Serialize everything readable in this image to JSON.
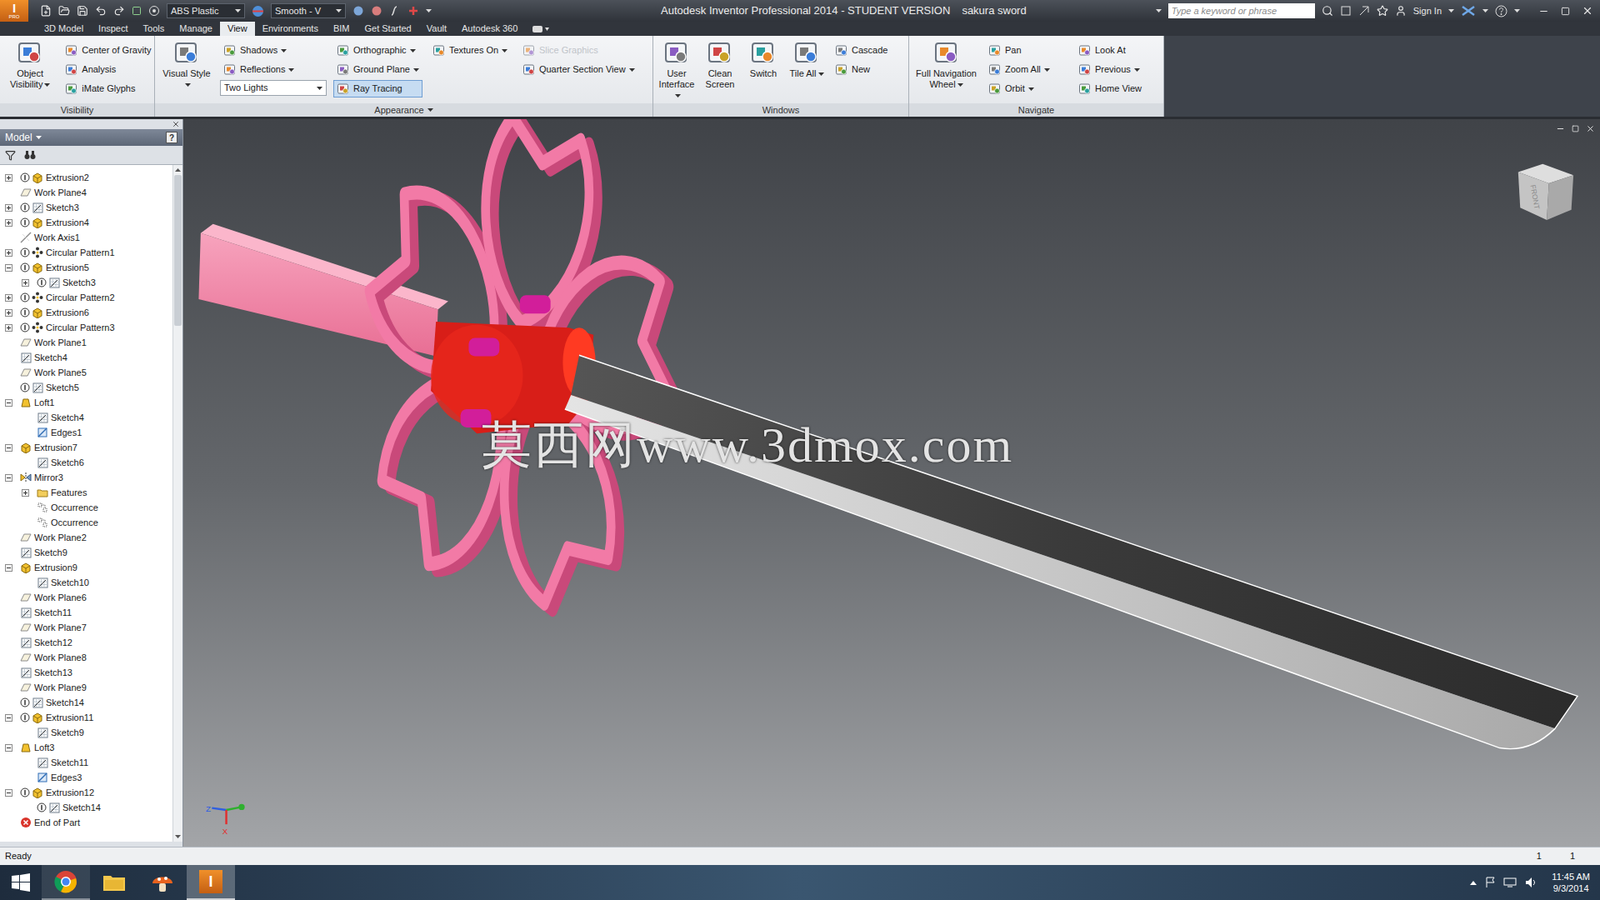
{
  "window": {
    "app_letter": "I",
    "app_edition": "PRO",
    "title": "Autodesk Inventor Professional 2014 - STUDENT VERSION",
    "document": "sakura sword"
  },
  "quick_access": {
    "material": "ABS Plastic",
    "appearance": "Smooth - V"
  },
  "search": {
    "placeholder": "Type a keyword or phrase"
  },
  "account": {
    "sign_in": "Sign In"
  },
  "ribbon_tabs": [
    {
      "label": "3D Model",
      "selected": false
    },
    {
      "label": "Inspect",
      "selected": false
    },
    {
      "label": "Tools",
      "selected": false
    },
    {
      "label": "Manage",
      "selected": false
    },
    {
      "label": "View",
      "selected": true
    },
    {
      "label": "Environments",
      "selected": false
    },
    {
      "label": "BIM",
      "selected": false
    },
    {
      "label": "Get Started",
      "selected": false
    },
    {
      "label": "Vault",
      "selected": false
    },
    {
      "label": "Autodesk 360",
      "selected": false
    }
  ],
  "ribbon_panels": [
    {
      "title": "Visibility",
      "dropdown": false,
      "large": [
        {
          "label": "Object Visibility",
          "dropdown": true
        }
      ],
      "columns": [
        [
          {
            "label": "Center of Gravity",
            "kind": "button",
            "dropdown": false,
            "selected": false,
            "disabled": false
          },
          {
            "label": "Analysis",
            "kind": "button",
            "dropdown": false,
            "selected": false,
            "disabled": false
          },
          {
            "label": "iMate Glyphs",
            "kind": "button",
            "dropdown": false,
            "selected": false,
            "disabled": false
          }
        ]
      ]
    },
    {
      "title": "Appearance",
      "dropdown": true,
      "large": [
        {
          "label": "Visual Style",
          "dropdown": true
        }
      ],
      "columns": [
        [
          {
            "label": "Shadows",
            "kind": "button",
            "dropdown": true,
            "selected": false,
            "disabled": false
          },
          {
            "label": "Reflections",
            "kind": "button",
            "dropdown": true,
            "selected": false,
            "disabled": false
          },
          {
            "label": "Two Lights",
            "kind": "combo",
            "dropdown": true,
            "selected": false,
            "disabled": false
          }
        ],
        [
          {
            "label": "Orthographic",
            "kind": "button",
            "dropdown": true,
            "selected": false,
            "disabled": false
          },
          {
            "label": "Ground Plane",
            "kind": "button",
            "dropdown": true,
            "selected": false,
            "disabled": false
          },
          {
            "label": "Ray Tracing",
            "kind": "button",
            "dropdown": false,
            "selected": true,
            "disabled": false
          }
        ],
        [
          {
            "label": "Textures On",
            "kind": "button",
            "dropdown": true,
            "selected": false,
            "disabled": false
          }
        ],
        [
          {
            "label": "Slice Graphics",
            "kind": "button",
            "dropdown": false,
            "selected": false,
            "disabled": true
          },
          {
            "label": "Quarter Section View",
            "kind": "button",
            "dropdown": true,
            "selected": false,
            "disabled": false
          }
        ]
      ]
    },
    {
      "title": "Windows",
      "dropdown": false,
      "large": [
        {
          "label": "User Interface",
          "dropdown": true
        },
        {
          "label": "Clean Screen",
          "dropdown": false
        },
        {
          "label": "Switch",
          "dropdown": false
        },
        {
          "label": "Tile All",
          "dropdown": true
        }
      ],
      "columns": [
        [
          {
            "label": "Cascade",
            "kind": "button",
            "dropdown": false,
            "selected": false,
            "disabled": false
          },
          {
            "label": "New",
            "kind": "button",
            "dropdown": false,
            "selected": false,
            "disabled": false
          }
        ]
      ]
    },
    {
      "title": "Navigate",
      "dropdown": false,
      "large": [
        {
          "label": "Full Navigation Wheel",
          "dropdown": true
        }
      ],
      "columns": [
        [
          {
            "label": "Pan",
            "kind": "button",
            "dropdown": false,
            "selected": false,
            "disabled": false
          },
          {
            "label": "Zoom All",
            "kind": "button",
            "dropdown": true,
            "selected": false,
            "disabled": false
          },
          {
            "label": "Orbit",
            "kind": "button",
            "dropdown": true,
            "selected": false,
            "disabled": false
          }
        ],
        [
          {
            "label": "Look At",
            "kind": "button",
            "dropdown": false,
            "selected": false,
            "disabled": false
          },
          {
            "label": "Previous",
            "kind": "button",
            "dropdown": true,
            "selected": false,
            "disabled": false
          },
          {
            "label": "Home View",
            "kind": "button",
            "dropdown": false,
            "selected": false,
            "disabled": false
          }
        ]
      ]
    }
  ],
  "browser": {
    "title": "Model",
    "help": "?",
    "scroll_level": 0.23,
    "items": [
      {
        "label": "Extrusion2",
        "level": 0,
        "expandable": true,
        "expanded": false,
        "note": true,
        "kind": "extrusion"
      },
      {
        "label": "Work Plane4",
        "level": 0,
        "expandable": false,
        "expanded": false,
        "note": false,
        "kind": "workplane"
      },
      {
        "label": "Sketch3",
        "level": 0,
        "expandable": true,
        "expanded": false,
        "note": true,
        "kind": "sketch"
      },
      {
        "label": "Extrusion4",
        "level": 0,
        "expandable": true,
        "expanded": false,
        "note": true,
        "kind": "extrusion"
      },
      {
        "label": "Work Axis1",
        "level": 0,
        "expandable": false,
        "expanded": false,
        "note": false,
        "kind": "axis"
      },
      {
        "label": "Circular Pattern1",
        "level": 0,
        "expandable": true,
        "expanded": false,
        "note": true,
        "kind": "pattern"
      },
      {
        "label": "Extrusion5",
        "level": 0,
        "expandable": true,
        "expanded": true,
        "note": true,
        "kind": "extrusion"
      },
      {
        "label": "Sketch3",
        "level": 1,
        "expandable": true,
        "expanded": false,
        "note": true,
        "kind": "sketch"
      },
      {
        "label": "Circular Pattern2",
        "level": 0,
        "expandable": true,
        "expanded": false,
        "note": true,
        "kind": "pattern"
      },
      {
        "label": "Extrusion6",
        "level": 0,
        "expandable": true,
        "expanded": false,
        "note": true,
        "kind": "extrusion"
      },
      {
        "label": "Circular Pattern3",
        "level": 0,
        "expandable": true,
        "expanded": false,
        "note": true,
        "kind": "pattern"
      },
      {
        "label": "Work Plane1",
        "level": 0,
        "expandable": false,
        "expanded": false,
        "note": false,
        "kind": "workplane"
      },
      {
        "label": "Sketch4",
        "level": 0,
        "expandable": false,
        "expanded": false,
        "note": false,
        "kind": "sketch"
      },
      {
        "label": "Work Plane5",
        "level": 0,
        "expandable": false,
        "expanded": false,
        "note": false,
        "kind": "workplane"
      },
      {
        "label": "Sketch5",
        "level": 0,
        "expandable": false,
        "expanded": false,
        "note": true,
        "kind": "sketch"
      },
      {
        "label": "Loft1",
        "level": 0,
        "expandable": true,
        "expanded": true,
        "note": false,
        "kind": "loft"
      },
      {
        "label": "Sketch4",
        "level": 1,
        "expandable": false,
        "expanded": false,
        "note": false,
        "kind": "sketch"
      },
      {
        "label": "Edges1",
        "level": 1,
        "expandable": false,
        "expanded": false,
        "note": false,
        "kind": "edges"
      },
      {
        "label": "Extrusion7",
        "level": 0,
        "expandable": true,
        "expanded": true,
        "note": false,
        "kind": "extrusion"
      },
      {
        "label": "Sketch6",
        "level": 1,
        "expandable": false,
        "expanded": false,
        "note": false,
        "kind": "sketch"
      },
      {
        "label": "Mirror3",
        "level": 0,
        "expandable": true,
        "expanded": true,
        "note": false,
        "kind": "mirror"
      },
      {
        "label": "Features",
        "level": 1,
        "expandable": true,
        "expanded": false,
        "note": false,
        "kind": "folder"
      },
      {
        "label": "Occurrence",
        "level": 1,
        "expandable": false,
        "expanded": false,
        "note": false,
        "kind": "occurrence"
      },
      {
        "label": "Occurrence",
        "level": 1,
        "expandable": false,
        "expanded": false,
        "note": false,
        "kind": "occurrence"
      },
      {
        "label": "Work Plane2",
        "level": 0,
        "expandable": false,
        "expanded": false,
        "note": false,
        "kind": "workplane"
      },
      {
        "label": "Sketch9",
        "level": 0,
        "expandable": false,
        "expanded": false,
        "note": false,
        "kind": "sketch"
      },
      {
        "label": "Extrusion9",
        "level": 0,
        "expandable": true,
        "expanded": true,
        "note": false,
        "kind": "extrusion"
      },
      {
        "label": "Sketch10",
        "level": 1,
        "expandable": false,
        "expanded": false,
        "note": false,
        "kind": "sketch"
      },
      {
        "label": "Work Plane6",
        "level": 0,
        "expandable": false,
        "expanded": false,
        "note": false,
        "kind": "workplane"
      },
      {
        "label": "Sketch11",
        "level": 0,
        "expandable": false,
        "expanded": false,
        "note": false,
        "kind": "sketch"
      },
      {
        "label": "Work Plane7",
        "level": 0,
        "expandable": false,
        "expanded": false,
        "note": false,
        "kind": "workplane"
      },
      {
        "label": "Sketch12",
        "level": 0,
        "expandable": false,
        "expanded": false,
        "note": false,
        "kind": "sketch"
      },
      {
        "label": "Work Plane8",
        "level": 0,
        "expandable": false,
        "expanded": false,
        "note": false,
        "kind": "workplane"
      },
      {
        "label": "Sketch13",
        "level": 0,
        "expandable": false,
        "expanded": false,
        "note": false,
        "kind": "sketch"
      },
      {
        "label": "Work Plane9",
        "level": 0,
        "expandable": false,
        "expanded": false,
        "note": false,
        "kind": "workplane"
      },
      {
        "label": "Sketch14",
        "level": 0,
        "expandable": false,
        "expanded": false,
        "note": true,
        "kind": "sketch"
      },
      {
        "label": "Extrusion11",
        "level": 0,
        "expandable": true,
        "expanded": true,
        "note": true,
        "kind": "extrusion"
      },
      {
        "label": "Sketch9",
        "level": 1,
        "expandable": false,
        "expanded": false,
        "note": false,
        "kind": "sketch"
      },
      {
        "label": "Loft3",
        "level": 0,
        "expandable": true,
        "expanded": true,
        "note": false,
        "kind": "loft"
      },
      {
        "label": "Sketch11",
        "level": 1,
        "expandable": false,
        "expanded": false,
        "note": false,
        "kind": "sketch"
      },
      {
        "label": "Edges3",
        "level": 1,
        "expandable": false,
        "expanded": false,
        "note": false,
        "kind": "edges"
      },
      {
        "label": "Extrusion12",
        "level": 0,
        "expandable": true,
        "expanded": true,
        "note": true,
        "kind": "extrusion"
      },
      {
        "label": "Sketch14",
        "level": 1,
        "expandable": false,
        "expanded": false,
        "note": true,
        "kind": "sketch"
      },
      {
        "label": "End of Part",
        "level": 0,
        "expandable": false,
        "expanded": false,
        "note": false,
        "kind": "end"
      }
    ]
  },
  "viewport": {
    "watermark": "莫西网www.3dmox.com",
    "viewcube_face": "FRONT",
    "triad": [
      "Z",
      "X"
    ]
  },
  "status_bar": {
    "text": "Ready",
    "counts": [
      "1",
      "1"
    ]
  },
  "taskbar": {
    "time": "11:45 AM",
    "date": "9/3/2014"
  }
}
